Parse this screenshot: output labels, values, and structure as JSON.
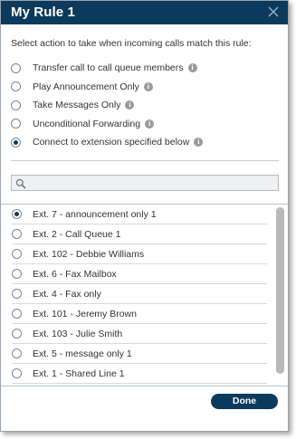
{
  "dialog": {
    "title": "My Rule 1",
    "prompt": "Select action to take when incoming calls match this rule:"
  },
  "options": [
    {
      "label": "Transfer call to call queue members",
      "checked": false
    },
    {
      "label": "Play Announcement Only",
      "checked": false
    },
    {
      "label": "Take Messages Only",
      "checked": false
    },
    {
      "label": "Unconditional Forwarding",
      "checked": false
    },
    {
      "label": "Connect to extension specified below",
      "checked": true
    }
  ],
  "search": {
    "value": "",
    "placeholder": ""
  },
  "extensions": [
    {
      "label": "Ext. 7 - announcement only 1",
      "checked": true
    },
    {
      "label": "Ext. 2 - Call Queue 1",
      "checked": false
    },
    {
      "label": "Ext. 102 - Debbie Williams",
      "checked": false
    },
    {
      "label": "Ext. 6 - Fax Mailbox",
      "checked": false
    },
    {
      "label": "Ext. 4 - Fax only",
      "checked": false
    },
    {
      "label": "Ext. 101 - Jeremy Brown",
      "checked": false
    },
    {
      "label": "Ext. 103 - Julie Smith",
      "checked": false
    },
    {
      "label": "Ext. 5 - message only 1",
      "checked": false
    },
    {
      "label": "Ext. 1 - Shared Line 1",
      "checked": false
    }
  ],
  "footer": {
    "done_label": "Done"
  },
  "colors": {
    "titlebar": "#0b3a5c",
    "accent": "#0b3a5c"
  }
}
